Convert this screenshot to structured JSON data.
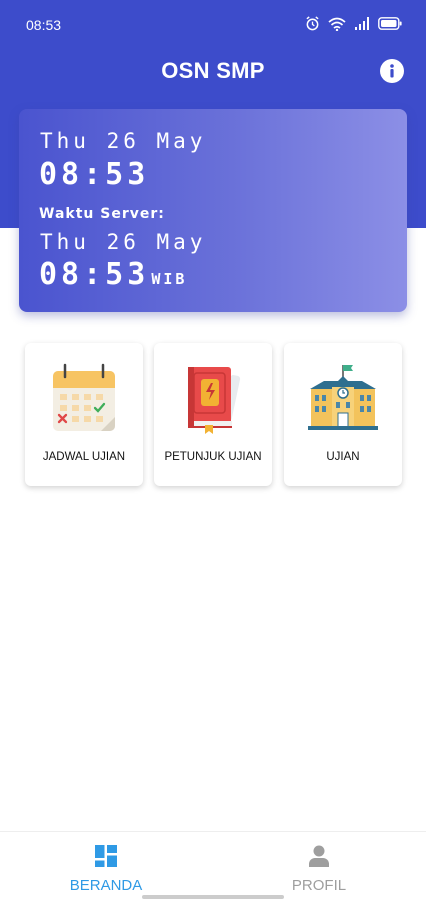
{
  "status_bar": {
    "time": "08:53",
    "icons": [
      "alarm-icon",
      "wifi-icon",
      "signal-icon",
      "battery-icon"
    ]
  },
  "header": {
    "title": "OSN SMP",
    "info_icon": "info-icon",
    "color": "#3d4ccb"
  },
  "clock_card": {
    "device_date": "Thu 26 May",
    "device_time": "08:53",
    "server_label": "Waktu Server:",
    "server_date": "Thu 26 May",
    "server_time": "08:53",
    "timezone": "WIB"
  },
  "menu": [
    {
      "label": "JADWAL UJIAN",
      "icon": "calendar-icon"
    },
    {
      "label": "PETUNJUK UJIAN",
      "icon": "book-icon"
    },
    {
      "label": "UJIAN",
      "icon": "school-building-icon"
    }
  ],
  "bottom_nav": [
    {
      "label": "BERANDA",
      "icon": "dashboard-icon",
      "active": true,
      "color": "#2f9ae5"
    },
    {
      "label": "PROFIL",
      "icon": "person-icon",
      "active": false,
      "color": "#9e9e9e"
    }
  ]
}
